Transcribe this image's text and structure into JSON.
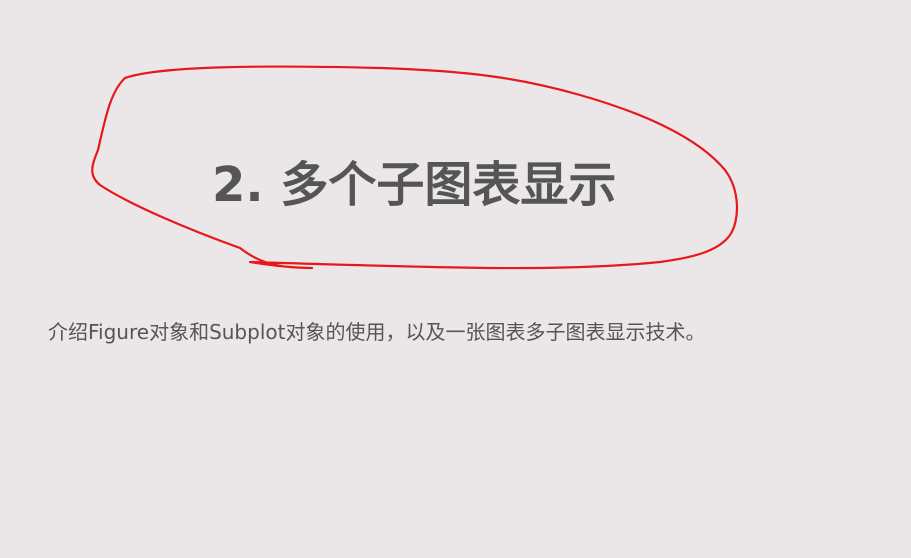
{
  "slide": {
    "title": "2. 多个子图表显示",
    "subtitle": "介绍Figure对象和Subplot对象的使用，以及一张图表多子图表显示技术。"
  },
  "annotation": {
    "shape": "hand-drawn-ellipse",
    "color": "#e8171b"
  },
  "colors": {
    "background": "#ebe7e8",
    "text": "#555555"
  }
}
